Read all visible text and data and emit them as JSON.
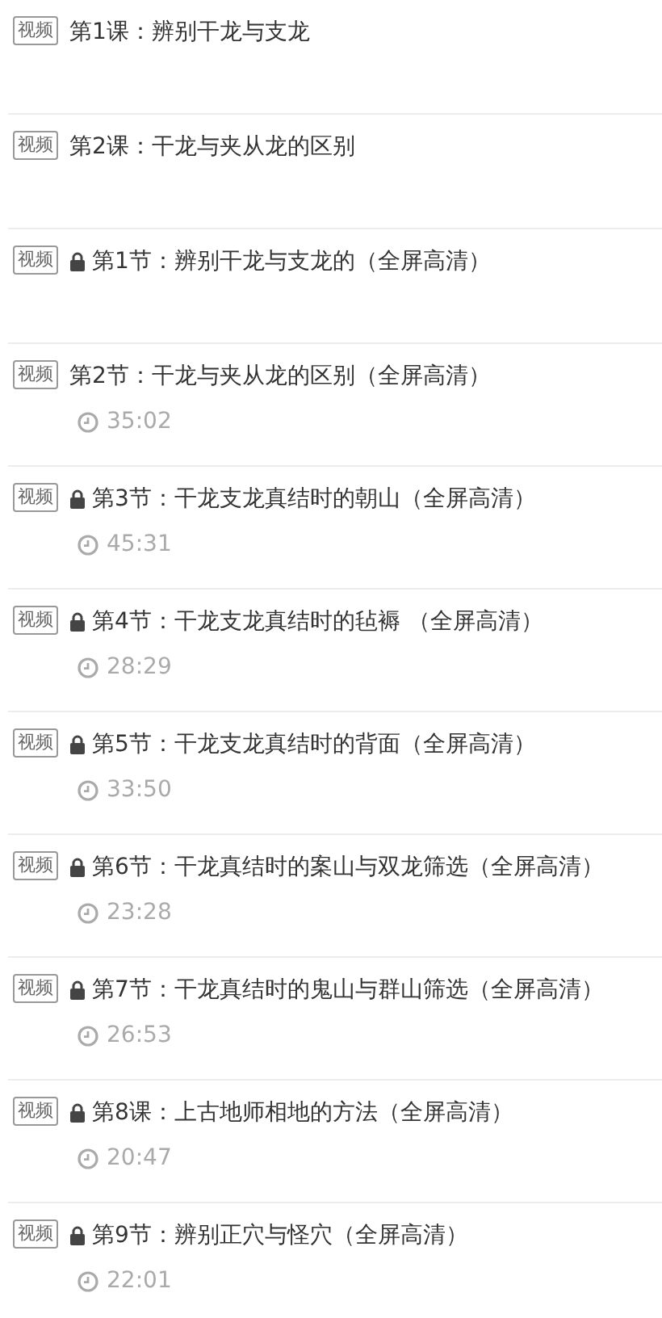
{
  "lessons": [
    {
      "tag": "视频",
      "locked": false,
      "title": "第1课：辨别干龙与支龙"
    },
    {
      "tag": "视频",
      "locked": false,
      "title": "第2课：干龙与夹从龙的区别"
    },
    {
      "tag": "视频",
      "locked": true,
      "title": "第1节：辨别干龙与支龙的（全屏高清）"
    },
    {
      "tag": "视频",
      "locked": false,
      "title": "第2节：干龙与夹从龙的区别（全屏高清）",
      "duration": "35:02"
    },
    {
      "tag": "视频",
      "locked": true,
      "title": "第3节：干龙支龙真结时的朝山（全屏高清）",
      "duration": "45:31"
    },
    {
      "tag": "视频",
      "locked": true,
      "title": "第4节：干龙支龙真结时的毡褥 （全屏高清）",
      "duration": "28:29"
    },
    {
      "tag": "视频",
      "locked": true,
      "title": "第5节：干龙支龙真结时的背面（全屏高清）",
      "duration": "33:50"
    },
    {
      "tag": "视频",
      "locked": true,
      "title": "第6节：干龙真结时的案山与双龙筛选（全屏高清）",
      "duration": "23:28"
    },
    {
      "tag": "视频",
      "locked": true,
      "title": "第7节：干龙真结时的鬼山与群山筛选（全屏高清）",
      "duration": "26:53"
    },
    {
      "tag": "视频",
      "locked": true,
      "title": "第8课：上古地师相地的方法（全屏高清）",
      "duration": "20:47"
    },
    {
      "tag": "视频",
      "locked": true,
      "title": "第9节：辨别正穴与怪穴（全屏高清）",
      "duration": "22:01"
    }
  ]
}
